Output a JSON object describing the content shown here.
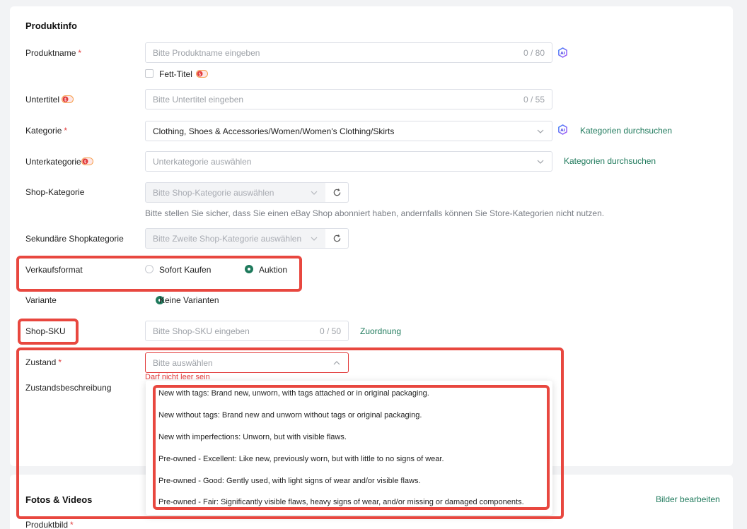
{
  "section_productinfo": {
    "title": "Produktinfo"
  },
  "product_name": {
    "label": "Produktname",
    "placeholder": "Bitte Produktname eingeben",
    "counter": "0 / 80"
  },
  "bold_title": {
    "label": "Fett-Titel"
  },
  "subtitle": {
    "label": "Untertitel",
    "placeholder": "Bitte Untertitel eingeben",
    "counter": "0 / 55"
  },
  "category": {
    "label": "Kategorie",
    "value": "Clothing, Shoes & Accessories/Women/Women's Clothing/Skirts",
    "search_link": "Kategorien durchsuchen"
  },
  "subcategory": {
    "label": "Unterkategorie",
    "placeholder": "Unterkategorie auswählen",
    "search_link": "Kategorien durchsuchen"
  },
  "shop_category": {
    "label": "Shop-Kategorie",
    "placeholder": "Bitte Shop-Kategorie auswählen",
    "hint": "Bitte stellen Sie sicher, dass Sie einen eBay Shop abonniert haben, andernfalls können Sie Store-Kategorien nicht nutzen."
  },
  "secondary_shop_category": {
    "label": "Sekundäre Shopkategorie",
    "placeholder": "Bitte Zweite Shop-Kategorie auswählen"
  },
  "sales_format": {
    "label": "Verkaufsformat",
    "options": [
      "Sofort Kaufen",
      "Auktion"
    ],
    "selected": "Auktion"
  },
  "variant": {
    "label": "Variante",
    "option": "Keine Varianten"
  },
  "shop_sku": {
    "label": "Shop-SKU",
    "placeholder": "Bitte Shop-SKU eingeben",
    "counter": "0 / 50",
    "link": "Zuordnung"
  },
  "condition": {
    "label": "Zustand",
    "placeholder": "Bitte auswählen",
    "error": "Darf nicht leer sein",
    "options": [
      "New with tags: Brand new, unworn, with tags attached or in original packaging.",
      "New without tags: Brand new and unworn without tags or original packaging.",
      "New with imperfections: Unworn, but with visible flaws.",
      "Pre-owned - Excellent: Like new, previously worn, but with little to no signs of wear.",
      "Pre-owned - Good: Gently used, with light signs of wear and/or visible flaws.",
      "Pre-owned - Fair: Significantly visible flaws, heavy signs of wear, and/or missing or damaged components."
    ]
  },
  "condition_description": {
    "label": "Zustandsbeschreibung"
  },
  "section_media": {
    "title": "Fotos & Videos",
    "edit_link": "Bilder bearbeiten"
  },
  "product_image": {
    "label": "Produktbild"
  },
  "colors": {
    "accent": "#1f7a5c",
    "error": "#e23b3b",
    "highlight": "#e8473f"
  }
}
